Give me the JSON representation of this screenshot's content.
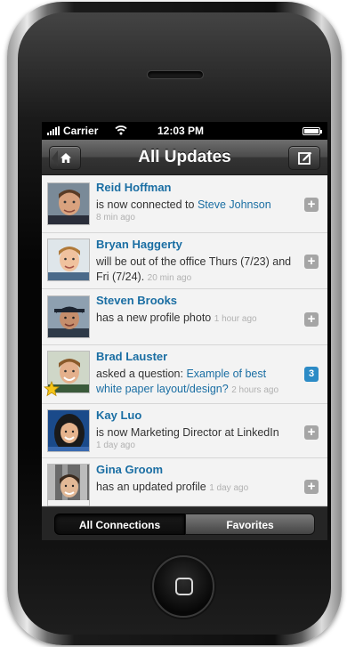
{
  "status_bar": {
    "carrier": "Carrier",
    "time": "12:03 PM"
  },
  "nav": {
    "title": "All Updates",
    "left_icon": "home-icon",
    "right_icon": "compose-icon"
  },
  "updates": [
    {
      "name": "Reid Hoffman",
      "text": "is now connected to ",
      "link": "Steve Johnson",
      "time_ago": "8 min ago",
      "action": "plus"
    },
    {
      "name": "Bryan Haggerty",
      "text": "will be out of the office Thurs (7/23) and Fri (7/24).",
      "time_ago": "20 min ago",
      "action": "plus"
    },
    {
      "name": "Steven Brooks",
      "text": "has a new profile photo",
      "time_ago": "1 hour ago",
      "action": "plus"
    },
    {
      "name": "Brad Lauster",
      "text": "asked a question: ",
      "link": "Example of best white paper layout/design?",
      "time_ago": "2 hours ago",
      "badge_count": "3"
    },
    {
      "name": "Kay Luo",
      "text": "is now Marketing Director at LinkedIn",
      "time_ago": "1 day ago",
      "action": "plus"
    },
    {
      "name": "Gina Groom",
      "text": "has an updated profile",
      "time_ago": "1 day ago",
      "action": "plus"
    }
  ],
  "tabs": [
    {
      "label": "All Connections",
      "selected": true
    },
    {
      "label": "Favorites",
      "selected": false
    }
  ],
  "colors": {
    "link": "#1a6ea3",
    "badge": "#2c8bc6",
    "nav_bar": "#3a3a3a"
  }
}
